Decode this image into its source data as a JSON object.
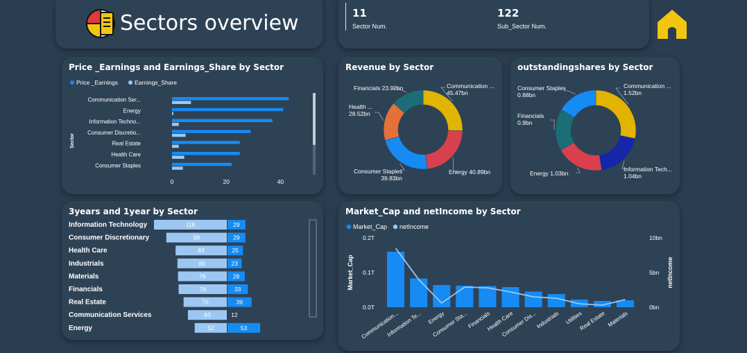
{
  "header": {
    "title": "Sectors overview",
    "back_icon": "arrow-left-circle-icon",
    "logo_icon": "pie-document-icon",
    "home_icon": "home-icon",
    "kpis": [
      {
        "value": "11",
        "label": "Sector Num."
      },
      {
        "value": "122",
        "label": "Sub_Sector Num."
      }
    ]
  },
  "colors": {
    "background": "#2b3d50",
    "card": "#2e4256",
    "bar_primary": "#168bf3",
    "bar_secondary": "#9cc7f3",
    "home": "#f2c511"
  },
  "charts": {
    "pe": {
      "title": "Price _Earnings and Earnings_Share by Sector"
    },
    "revenue": {
      "title": "Revenue by Sector"
    },
    "shares": {
      "title": "outstandingshares by Sector"
    },
    "years": {
      "title": "3years and 1year by Sector"
    },
    "mcap": {
      "title": "Market_Cap and netIncome by Sector"
    }
  },
  "chart_data": [
    {
      "id": "pe",
      "type": "bar",
      "orientation": "horizontal",
      "title": "Price _Earnings and Earnings_Share by Sector",
      "ylabel": "Sector",
      "categories": [
        "Communication Ser...",
        "Energy",
        "Information Techno...",
        "Consumer Discretio...",
        "Real Estate",
        "Health Care",
        "Consumer Staples"
      ],
      "series": [
        {
          "name": "Price _Earnings",
          "values": [
            43,
            41,
            37,
            29,
            25,
            25,
            22
          ],
          "color": "#168bf3"
        },
        {
          "name": "Earnings_Share",
          "values": [
            7,
            0.5,
            2.5,
            5,
            2.5,
            4.5,
            4
          ],
          "color": "#9cc7f3"
        }
      ],
      "xticks": [
        "0",
        "20",
        "40"
      ],
      "xlim": [
        0,
        45
      ],
      "legend": "top-left"
    },
    {
      "id": "revenue",
      "type": "pie",
      "donut": true,
      "title": "Revenue by Sector",
      "slices": [
        {
          "label": "Communication ...",
          "value": 45.47,
          "text": "45.47bn",
          "color": "#e0b400"
        },
        {
          "label": "Energy",
          "value": 40.89,
          "text": "40.89bn",
          "color": "#d9404e"
        },
        {
          "label": "Consumer Staples",
          "value": 39.83,
          "text": "39.83bn",
          "color": "#168bf3"
        },
        {
          "label": "Health ...",
          "value": 28.52,
          "text": "28.52bn",
          "color": "#e5703a"
        },
        {
          "label": "Financials",
          "value": 23.92,
          "text": "23.92bn",
          "color": "#1b6e77"
        }
      ]
    },
    {
      "id": "shares",
      "type": "pie",
      "donut": true,
      "title": "outstandingshares by Sector",
      "slices": [
        {
          "label": "Communication ...",
          "value": 1.52,
          "text": "1.52bn",
          "color": "#e0b400"
        },
        {
          "label": "Information Tech...",
          "value": 1.04,
          "text": "1.04bn",
          "color": "#1527a8"
        },
        {
          "label": "Energy",
          "value": 1.03,
          "text": "1.03bn",
          "color": "#d9404e"
        },
        {
          "label": "Financials",
          "value": 0.9,
          "text": "0.9bn",
          "color": "#1b6e77"
        },
        {
          "label": "Consumer Staples",
          "value": 0.88,
          "text": "0.88bn",
          "color": "#168bf3"
        }
      ]
    },
    {
      "id": "years",
      "type": "bar",
      "orientation": "horizontal-diverging",
      "title": "3years and 1year by Sector",
      "categories": [
        "Information Technology",
        "Consumer Discretionary",
        "Health Care",
        "Industrials",
        "Materials",
        "Financials",
        "Real Estate",
        "Communication Services",
        "Energy"
      ],
      "series": [
        {
          "name": "3years",
          "values": [
            118,
            98,
            83,
            80,
            79,
            78,
            70,
            63,
            52
          ],
          "color": "#9cc7f3"
        },
        {
          "name": "1year",
          "values": [
            29,
            29,
            25,
            23,
            28,
            33,
            39,
            12,
            53
          ],
          "color": "#168bf3"
        }
      ]
    },
    {
      "id": "mcap",
      "type": "bar",
      "title": "Market_Cap and netIncome by Sector",
      "ylabel": "Market_Cap",
      "y2label": "netIncome",
      "categories": [
        "Communication...",
        "Information Te...",
        "Energy",
        "Consumer Sta...",
        "Financials",
        "Health Care",
        "Consumer Dis...",
        "Industrials",
        "Utilities",
        "Real Estate",
        "Materials"
      ],
      "series": [
        {
          "name": "Market_Cap",
          "type": "bar",
          "axis": "left",
          "values": [
            0.16,
            0.083,
            0.064,
            0.062,
            0.061,
            0.058,
            0.045,
            0.038,
            0.022,
            0.018,
            0.02
          ],
          "color": "#168bf3"
        },
        {
          "name": "netIncome",
          "type": "line",
          "axis": "right",
          "values": [
            8.5,
            4.0,
            0.6,
            2.9,
            2.8,
            2.2,
            1.5,
            1.3,
            0.5,
            0.3,
            1.1
          ],
          "color": "#9cc7f3"
        }
      ],
      "yticks": [
        "0.0T",
        "0.1T",
        "0.2T"
      ],
      "ylim": [
        0,
        0.2
      ],
      "y2ticks": [
        "0bn",
        "5bn",
        "10bn"
      ],
      "y2lim": [
        0,
        10
      ],
      "legend": "top-left"
    }
  ]
}
